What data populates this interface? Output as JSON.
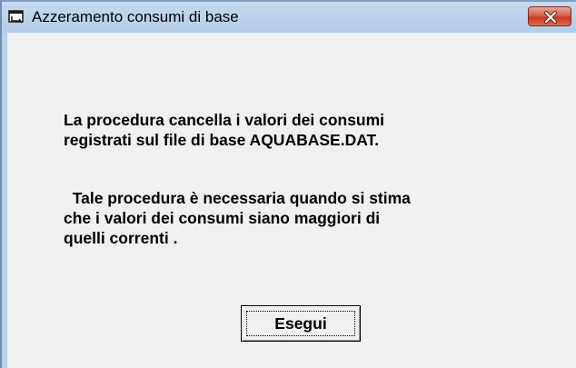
{
  "window": {
    "title": "Azzeramento consumi di base",
    "icon": "form-icon"
  },
  "titlebar": {
    "close_icon": "close-icon",
    "close_color": "#c8391f"
  },
  "message": {
    "paragraph1_line1": "La procedura cancella i valori dei consumi",
    "paragraph1_line2": "registrati sul file di base AQUABASE.DAT.",
    "paragraph2_line1": "  Tale procedura è necessaria quando si stima",
    "paragraph2_line2": "che i valori dei consumi siano maggiori di",
    "paragraph2_line3": "quelli correnti ."
  },
  "buttons": {
    "execute_label": "Esegui"
  }
}
